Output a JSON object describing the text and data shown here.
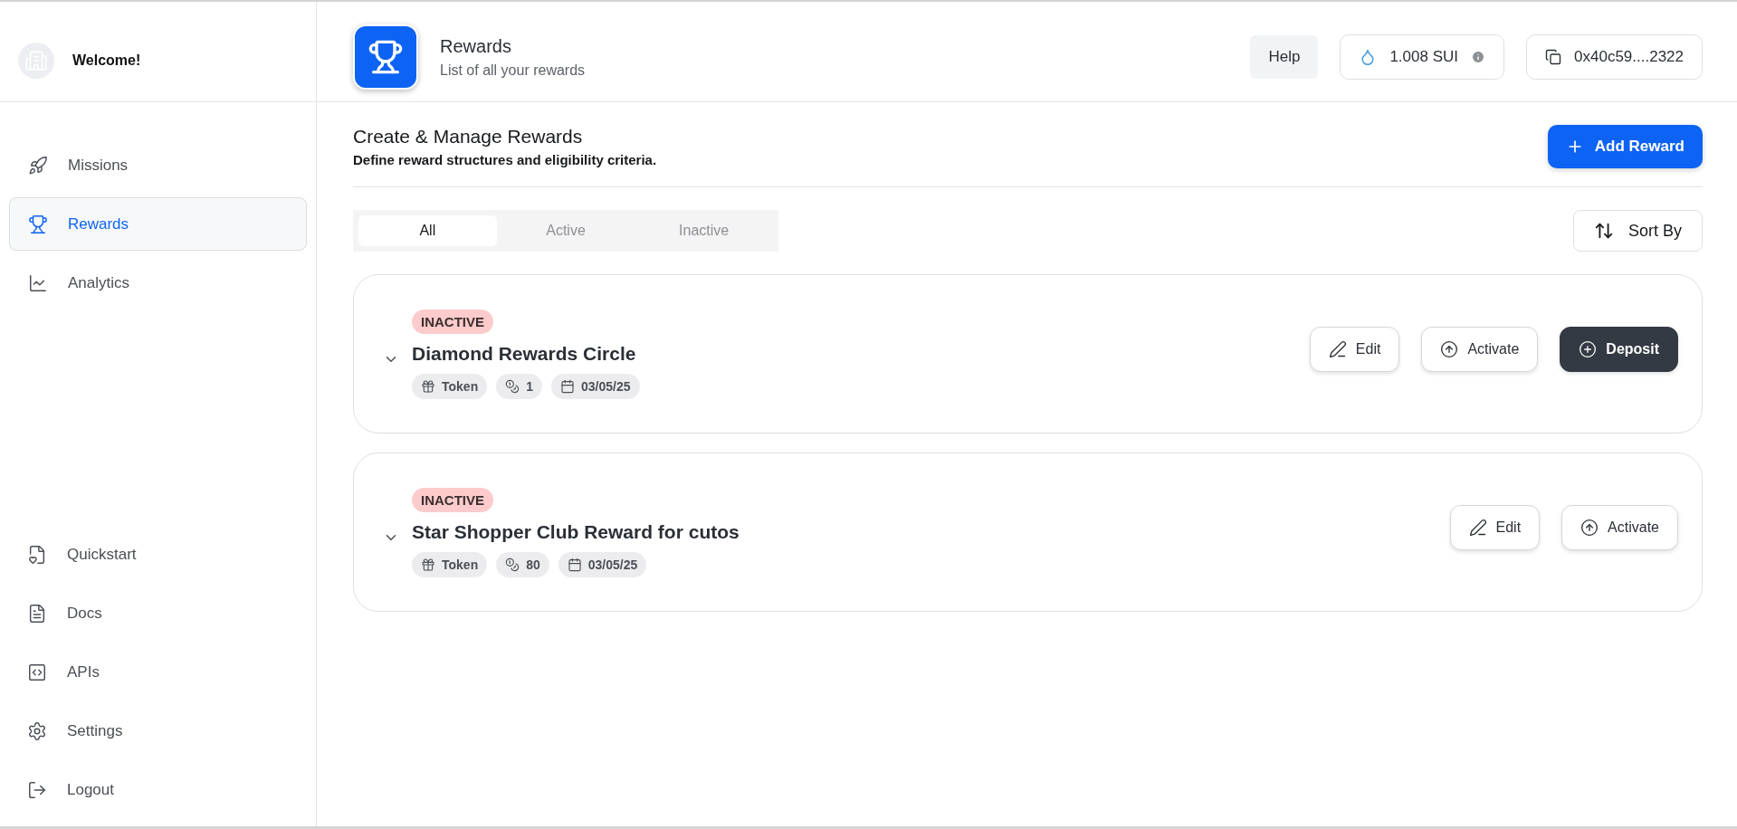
{
  "sidebar": {
    "welcome": "Welcome!",
    "items": [
      {
        "label": "Missions",
        "selected": false
      },
      {
        "label": "Rewards",
        "selected": true
      },
      {
        "label": "Analytics",
        "selected": false
      }
    ],
    "bottom_items": [
      {
        "label": "Quickstart"
      },
      {
        "label": "Docs"
      },
      {
        "label": "APIs"
      },
      {
        "label": "Settings"
      },
      {
        "label": "Logout"
      }
    ]
  },
  "header": {
    "title": "Rewards",
    "subtitle": "List of all your rewards",
    "help": "Help",
    "balance": "1.008 SUI",
    "address": "0x40c59....2322"
  },
  "section": {
    "title": "Create & Manage Rewards",
    "subtitle": "Define reward structures and eligibility criteria.",
    "add_button": "Add Reward"
  },
  "tabs": [
    {
      "label": "All",
      "selected": true
    },
    {
      "label": "Active",
      "selected": false
    },
    {
      "label": "Inactive",
      "selected": false
    }
  ],
  "sort_button": "Sort By",
  "rewards": [
    {
      "status": "INACTIVE",
      "title": "Diamond Rewards Circle",
      "chips": [
        {
          "kind": "type",
          "text": "Token"
        },
        {
          "kind": "amount",
          "text": "1"
        },
        {
          "kind": "date",
          "text": "03/05/25"
        }
      ],
      "actions": [
        {
          "kind": "edit",
          "label": "Edit"
        },
        {
          "kind": "activate",
          "label": "Activate"
        },
        {
          "kind": "deposit",
          "label": "Deposit"
        }
      ]
    },
    {
      "status": "INACTIVE",
      "title": "Star Shopper Club Reward for cutos",
      "chips": [
        {
          "kind": "type",
          "text": "Token"
        },
        {
          "kind": "amount",
          "text": "80"
        },
        {
          "kind": "date",
          "text": "03/05/25"
        }
      ],
      "actions": [
        {
          "kind": "edit",
          "label": "Edit"
        },
        {
          "kind": "activate",
          "label": "Activate"
        }
      ]
    }
  ]
}
